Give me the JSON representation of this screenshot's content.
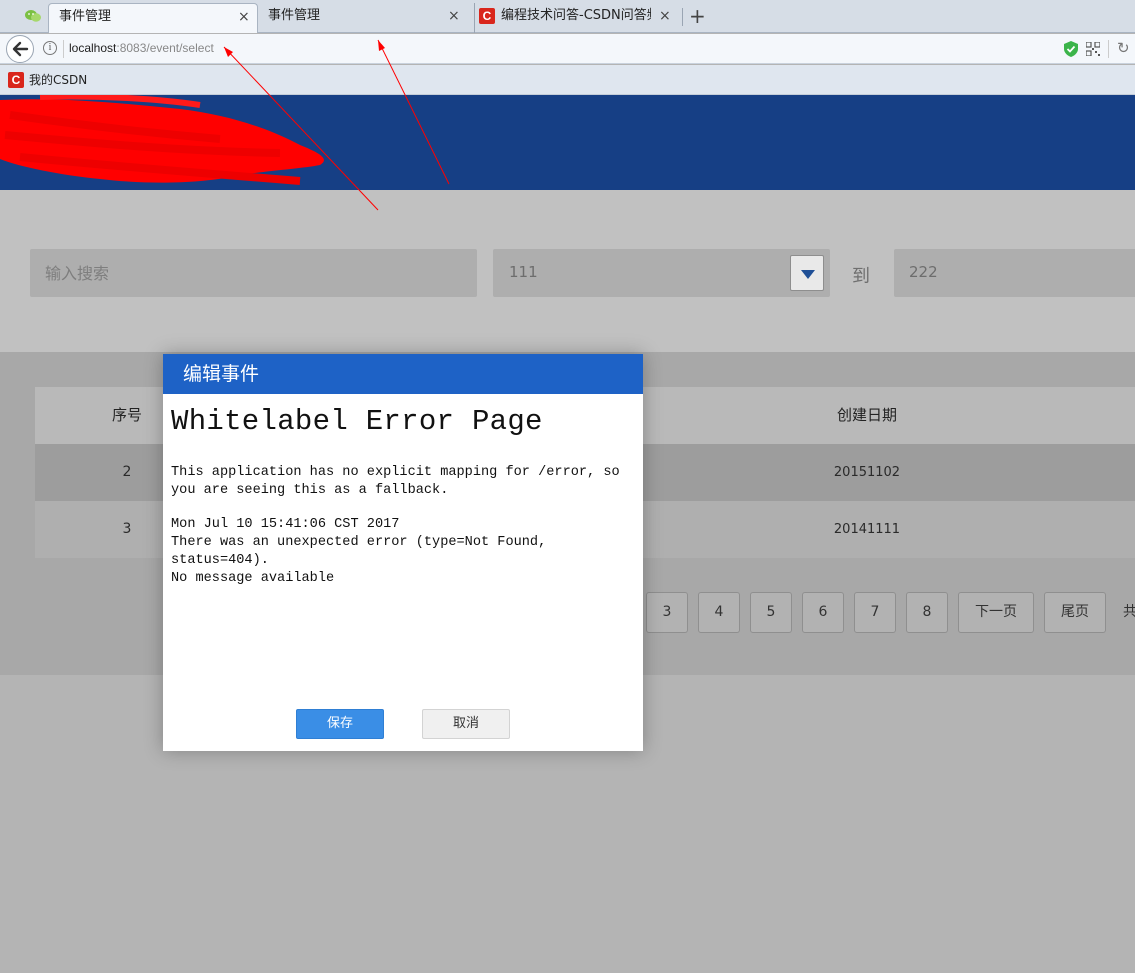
{
  "browser": {
    "tabs": [
      {
        "label": "事件管理",
        "close": "×"
      },
      {
        "label": "事件管理",
        "close": "×"
      },
      {
        "label": "编程技术问答-CSDN问答频道",
        "close": "×"
      }
    ],
    "new_tab": "+",
    "address": {
      "host": "localhost",
      "path": ":8083/event/select"
    },
    "bookmark": {
      "icon_text": "C",
      "label": "我的CSDN"
    }
  },
  "search": {
    "placeholder": "输入搜索",
    "from_value": "111",
    "to_label": "到",
    "to_value": "222"
  },
  "table": {
    "headers": {
      "seq": "序号",
      "date": "创建日期"
    },
    "rows": [
      {
        "seq": "2",
        "date": "20151102"
      },
      {
        "seq": "3",
        "date": "20141111"
      }
    ]
  },
  "pagination": {
    "pages": [
      "3",
      "4",
      "5",
      "6",
      "7",
      "8"
    ],
    "next": "下一页",
    "last": "尾页",
    "total_prefix": "共"
  },
  "modal": {
    "title": "编辑事件",
    "error_title": "Whitelabel Error Page",
    "error_line1": "This application has no explicit mapping for /error, so",
    "error_line2": "you are seeing this as a fallback.",
    "error_time": "Mon Jul 10 15:41:06 CST 2017",
    "error_line3": "There was an unexpected error (type=Not Found,",
    "error_line4": "status=404).",
    "error_line5": "No message available",
    "save_label": "保存",
    "cancel_label": "取消"
  },
  "colors": {
    "header_blue": "#163f85",
    "modal_header": "#1e62c6",
    "save_button": "#3a8ee6",
    "annotation_red": "#ff0000"
  }
}
